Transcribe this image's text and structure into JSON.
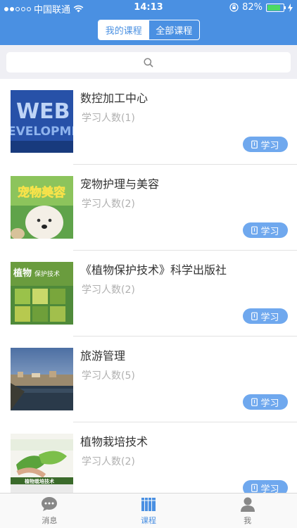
{
  "status_bar": {
    "carrier": "中国联通",
    "time": "14:13",
    "battery": "82%",
    "battery_level": 0.82,
    "signal_bars": 2
  },
  "segmented": {
    "my_courses": "我的课程",
    "all_courses": "全部课程"
  },
  "courses": [
    {
      "title": "数控加工中心",
      "learners": "学习人数(1)",
      "action": "学习"
    },
    {
      "title": "宠物护理与美容",
      "learners": "学习人数(2)",
      "action": "学习"
    },
    {
      "title": "《植物保护技术》科学出版社",
      "learners": "学习人数(2)",
      "action": "学习"
    },
    {
      "title": "旅游管理",
      "learners": "学习人数(5)",
      "action": "学习"
    },
    {
      "title": "植物栽培技术",
      "learners": "学习人数(2)",
      "action": "学习"
    }
  ],
  "tabs": {
    "messages": "消息",
    "courses": "课程",
    "me": "我"
  },
  "colors": {
    "accent": "#4a90e2",
    "study_button": "#6fa8ee"
  }
}
